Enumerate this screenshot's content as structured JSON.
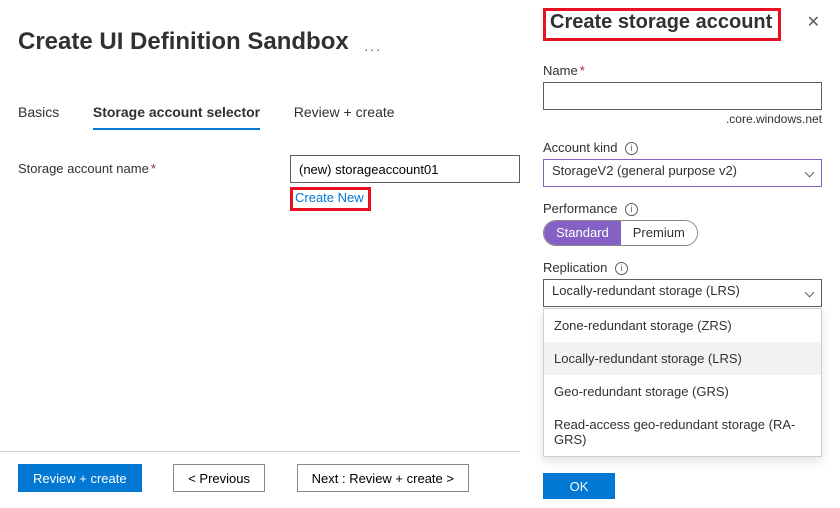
{
  "page": {
    "title": "Create UI Definition Sandbox",
    "more_icon": "..."
  },
  "tabs": [
    {
      "label": "Basics",
      "active": false
    },
    {
      "label": "Storage account selector",
      "active": true
    },
    {
      "label": "Review + create",
      "active": false
    }
  ],
  "form": {
    "storage_name_label": "Storage account name",
    "storage_name_value": "(new) storageaccount01",
    "create_new_label": "Create New"
  },
  "footer": {
    "review_btn": "Review + create",
    "prev_btn": "<  Previous",
    "next_btn": "Next : Review + create  >"
  },
  "panel": {
    "title": "Create storage account",
    "name_label": "Name",
    "name_value": "",
    "name_suffix": ".core.windows.net",
    "account_kind_label": "Account kind",
    "account_kind_value": "StorageV2 (general purpose v2)",
    "performance_label": "Performance",
    "performance_options": [
      {
        "label": "Standard",
        "selected": true
      },
      {
        "label": "Premium",
        "selected": false
      }
    ],
    "replication_label": "Replication",
    "replication_value": "Locally-redundant storage (LRS)",
    "replication_options": [
      {
        "label": "Zone-redundant storage (ZRS)"
      },
      {
        "label": "Locally-redundant storage (LRS)"
      },
      {
        "label": "Geo-redundant storage (GRS)"
      },
      {
        "label": "Read-access geo-redundant storage (RA-GRS)"
      }
    ],
    "ok_btn": "OK"
  }
}
